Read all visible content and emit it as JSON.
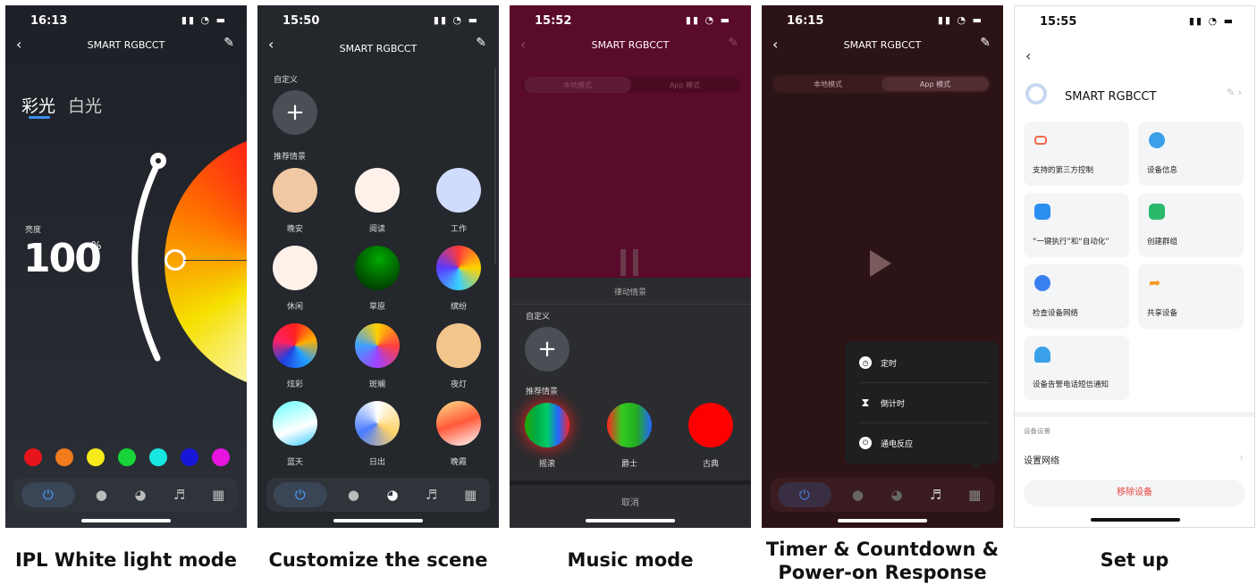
{
  "screens": [
    {
      "time": "16:13",
      "title": "SMART RGBCCT",
      "tabs": [
        "彩光",
        "白光"
      ],
      "brightness_label": "亮度",
      "brightness_value": "100",
      "brightness_unit": "%",
      "swatches": [
        "#e8141c",
        "#f07c1c",
        "#f7ea1a",
        "#19d33b",
        "#18e6e0",
        "#1816d6",
        "#e814e0"
      ]
    },
    {
      "time": "15:50",
      "title": "SMART RGBCCT",
      "custom_label": "自定义",
      "recommend_label": "推荐情景",
      "scenes": [
        "晚安",
        "阅读",
        "工作",
        "休闲",
        "草原",
        "缤纷",
        "炫彩",
        "斑斓",
        "夜灯",
        "蓝天",
        "日出",
        "晚霞"
      ]
    },
    {
      "time": "15:52",
      "title": "SMART RGBCCT",
      "mode_tabs": [
        "本地模式",
        "App 模式"
      ],
      "sheet_title": "律动情景",
      "custom_label": "自定义",
      "recommend_label": "推荐情景",
      "scenes": [
        "摇滚",
        "爵士",
        "古典"
      ],
      "cancel_label": "取消"
    },
    {
      "time": "16:15",
      "title": "SMART RGBCCT",
      "mode_tabs": [
        "本地模式",
        "App 模式"
      ],
      "menu_items": [
        "定时",
        "倒计时",
        "通电反应"
      ]
    },
    {
      "time": "15:55",
      "device_name": "SMART RGBCCT",
      "cards": [
        "支持的第三方控制",
        "设备信息",
        "“一键执行”和“自动化”",
        "创建群组",
        "检查设备网络",
        "共享设备",
        "设备告警电话短信通知"
      ],
      "settings_section": "设备设置",
      "network_label": "设置网络",
      "remove_label": "移除设备"
    }
  ],
  "captions": [
    "IPL White light mode",
    "Customize the scene",
    "Music mode",
    "Timer & Countdown & Power-on Response",
    "Set up"
  ]
}
